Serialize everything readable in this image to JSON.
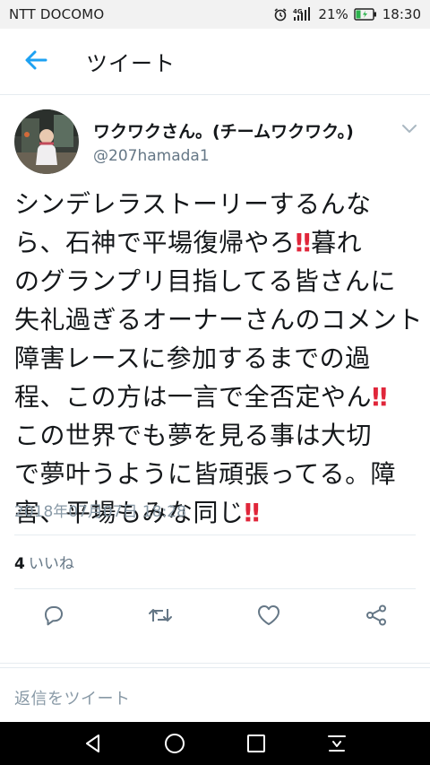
{
  "status_bar": {
    "carrier": "NTT DOCOMO",
    "network": "4G",
    "battery": "21%",
    "time": "18:30"
  },
  "app_bar": {
    "title": "ツイート"
  },
  "tweet": {
    "author_name": "ワクワクさん。(チームワクワク。)",
    "author_handle": "@207hamada1",
    "text_lines": [
      "シンデレラストーリーするんな",
      "ら、石神で平場復帰やろ",
      "暮れ",
      "のグランプリ目指してる皆さんに",
      "失礼過ぎるオーナーさんのコメント",
      "障害レースに参加するまでの過",
      "程、この方は一言で全否定やん",
      "この世界でも夢を見る事は大切",
      "で夢叶うように皆頑張ってる。障",
      "害、平場もみな同じ"
    ],
    "emoji": "‼",
    "timestamp": "2018年07月07日 18:28",
    "like_count": "4",
    "like_label": "いいね"
  },
  "reply": {
    "placeholder": "返信をツイート"
  },
  "colors": {
    "accent": "#1da1f2",
    "emoji_red": "#e0263a",
    "secondary_text": "#657786"
  },
  "icons": {
    "back": "arrow-left-icon",
    "caret": "chevron-down-icon",
    "reply": "reply-icon",
    "retweet": "retweet-icon",
    "like": "heart-icon",
    "share": "share-icon"
  }
}
